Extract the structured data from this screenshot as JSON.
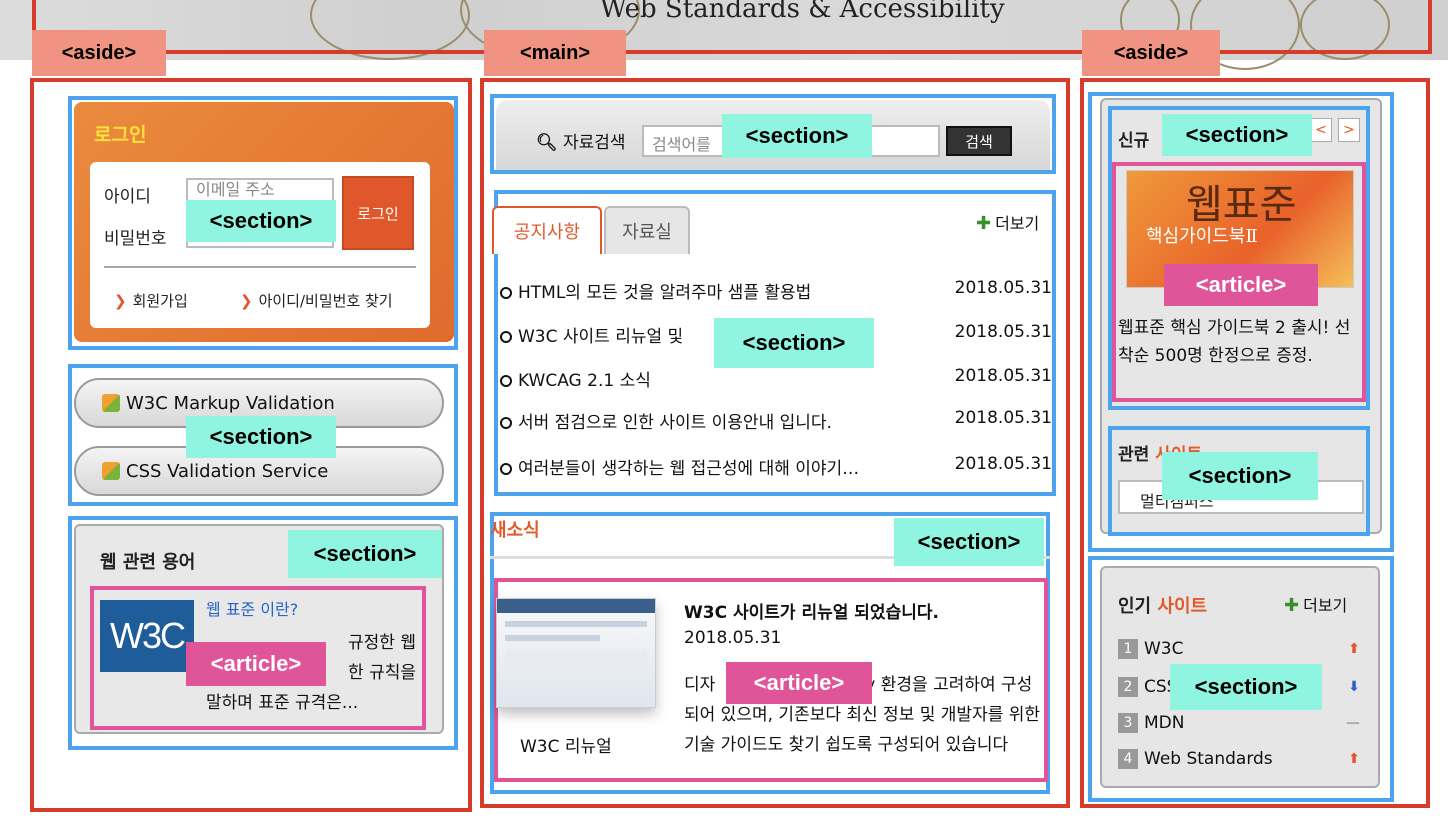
{
  "header": {
    "site_title": "Web Standards & Accessibility"
  },
  "tags": {
    "left_aside": "<aside>",
    "main": "<main>",
    "right_aside": "<aside>",
    "section": "<section>",
    "article": "<article>"
  },
  "login": {
    "title": "로그인",
    "id_label": "아이디",
    "id_placeholder": "이메일 주소",
    "pw_label": "비밀번호",
    "button": "로그인",
    "signup": "회원가입",
    "find": "아이디/비밀번호 찾기"
  },
  "validators": [
    {
      "label": "W3C Markup Validation"
    },
    {
      "label": "CSS Validation Service"
    }
  ],
  "terms": {
    "title": "웹 관련 용어",
    "logo_text": "W3C",
    "link": "웹 표준 이란?",
    "line1": "규정한 웹",
    "line2": "한 규칙을",
    "line3": "말하며 표준 규격은..."
  },
  "search": {
    "label": "자료검색",
    "placeholder": "검색어를",
    "button": "검색"
  },
  "notices": {
    "tab_active": "공지사항",
    "tab_inactive": "자료실",
    "more": "더보기",
    "rows": [
      {
        "title": "HTML의 모든 것을 알려주마 샘플 활용법",
        "date": "2018.05.31"
      },
      {
        "title": "W3C 사이트 리뉴얼 및",
        "date": "2018.05.31"
      },
      {
        "title": "KWCAG 2.1 소식",
        "date": "2018.05.31"
      },
      {
        "title": "서버 점검으로 인한 사이트 이용안내 입니다.",
        "date": "2018.05.31"
      },
      {
        "title": "여러분들이 생각하는 웹 접근성에 대해 이야기…",
        "date": "2018.05.31"
      }
    ]
  },
  "news": {
    "title": "새소식",
    "headline": "W3C 사이트가 리뉴얼 되었습니다.",
    "date": "2018.05.31",
    "body_start": "디자",
    "body_rest": "y 환경을 고려하여 구성되어 있으며, 기존보다 최신 정보 및 개발자를 위한 기술 가이드도 찾기 쉽도록 구성되어 있습니다",
    "caption": "W3C 리뉴얼"
  },
  "book": {
    "head": "신규",
    "prev": "<",
    "next": ">",
    "cover_title": "웹표준",
    "cover_sub": "핵심가이드북Ⅱ",
    "text": "웹표준 핵심 가이드북 2 출시! 선착순 500명 한정으로 증정."
  },
  "related": {
    "head": "관련",
    "head_accent": "사이트",
    "select_value": "멀티캠퍼스"
  },
  "popular": {
    "head": "인기",
    "head_accent": "사이트",
    "more": "더보기",
    "items": [
      {
        "rank": "1",
        "name": "W3C",
        "trend": "up"
      },
      {
        "rank": "2",
        "name": "CSS",
        "trend": "down"
      },
      {
        "rank": "3",
        "name": "MDN",
        "trend": "same"
      },
      {
        "rank": "4",
        "name": "Web Standards",
        "trend": "up"
      }
    ],
    "trend_colors": {
      "up": "#e0572b",
      "down": "#2a62c9",
      "same": "#aaaaaa"
    }
  }
}
